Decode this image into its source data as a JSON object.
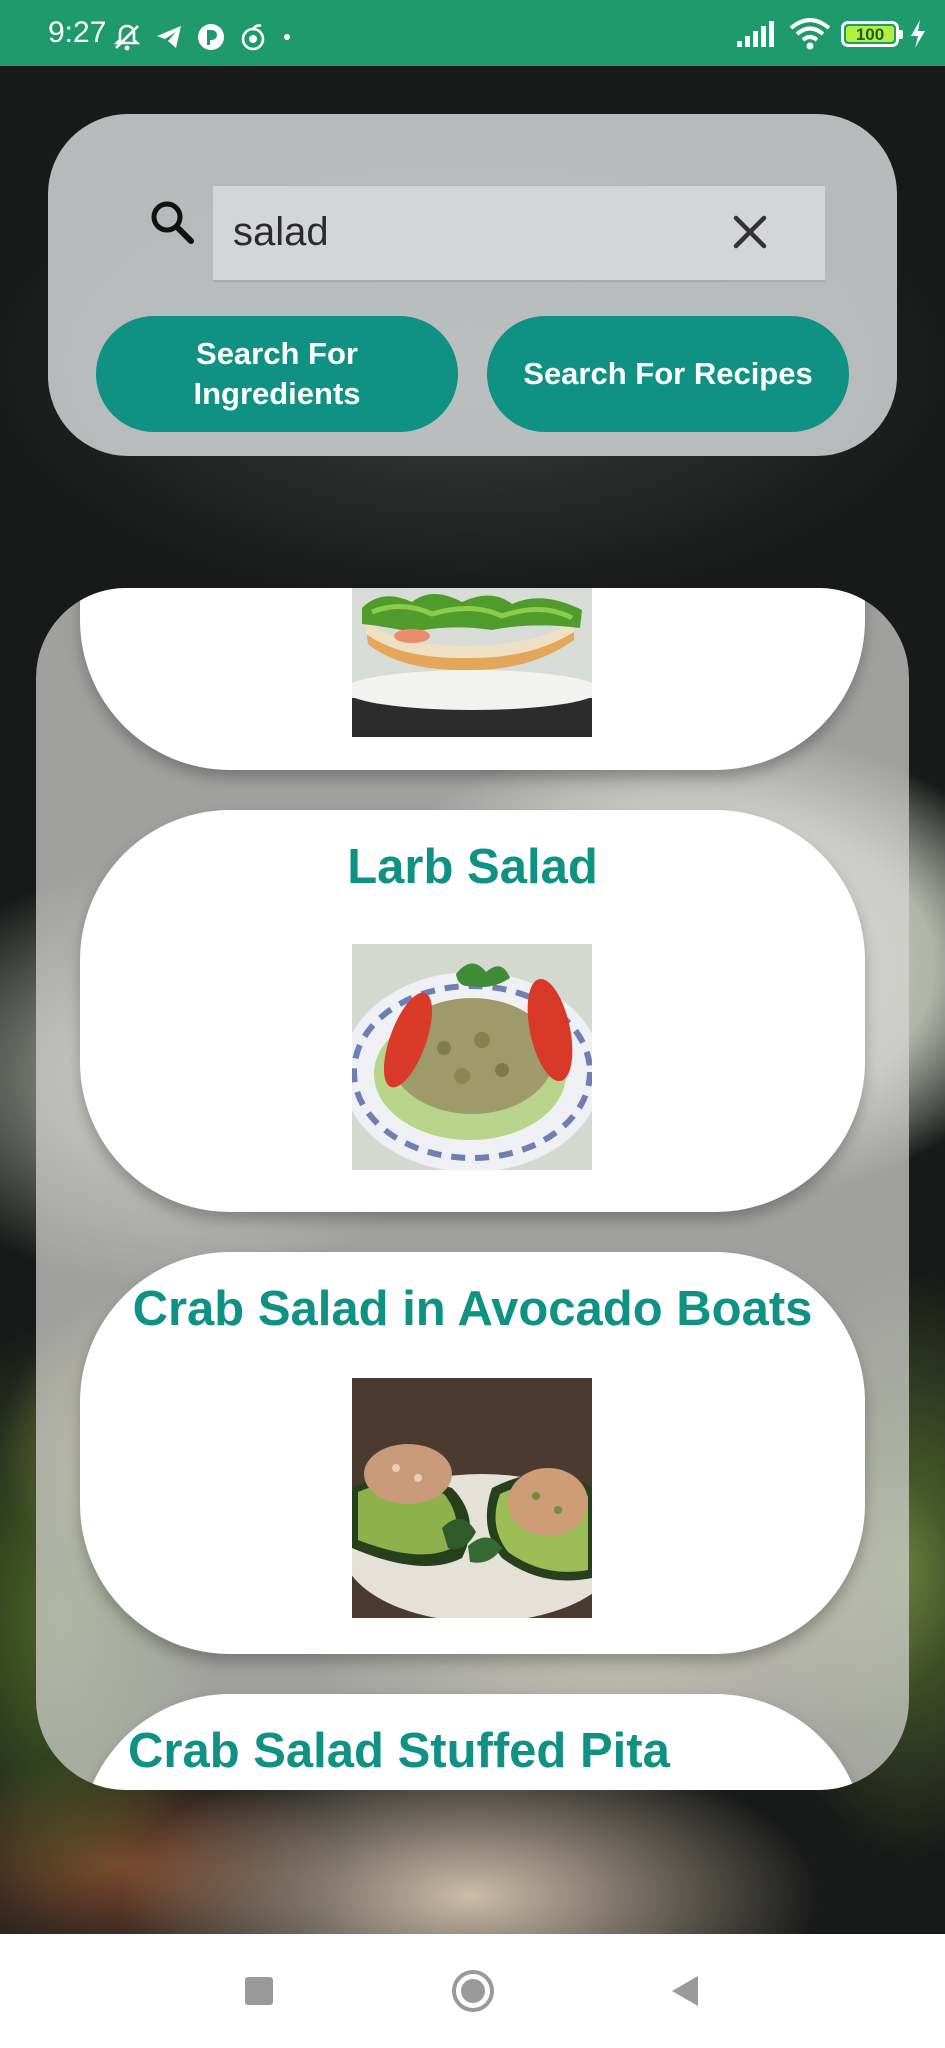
{
  "status_bar": {
    "time": "9:27",
    "battery": "100",
    "color": "#1f9a6c"
  },
  "search": {
    "query": "salad",
    "placeholder": "",
    "ingredients_button": "Search For Ingredients",
    "recipes_button": "Search For Recipes",
    "accent": "#0f9183"
  },
  "results": [
    {
      "title": "",
      "image": "bread-salad-photo"
    },
    {
      "title": "Larb Salad",
      "image": "larb-salad-photo"
    },
    {
      "title": "Crab Salad in Avocado Boats",
      "image": "crab-avocado-photo"
    },
    {
      "title": "Crab Salad Stuffed Pita",
      "image": ""
    }
  ],
  "nav": {
    "icons": [
      "recents-square-icon",
      "home-circle-icon",
      "back-triangle-icon"
    ]
  }
}
